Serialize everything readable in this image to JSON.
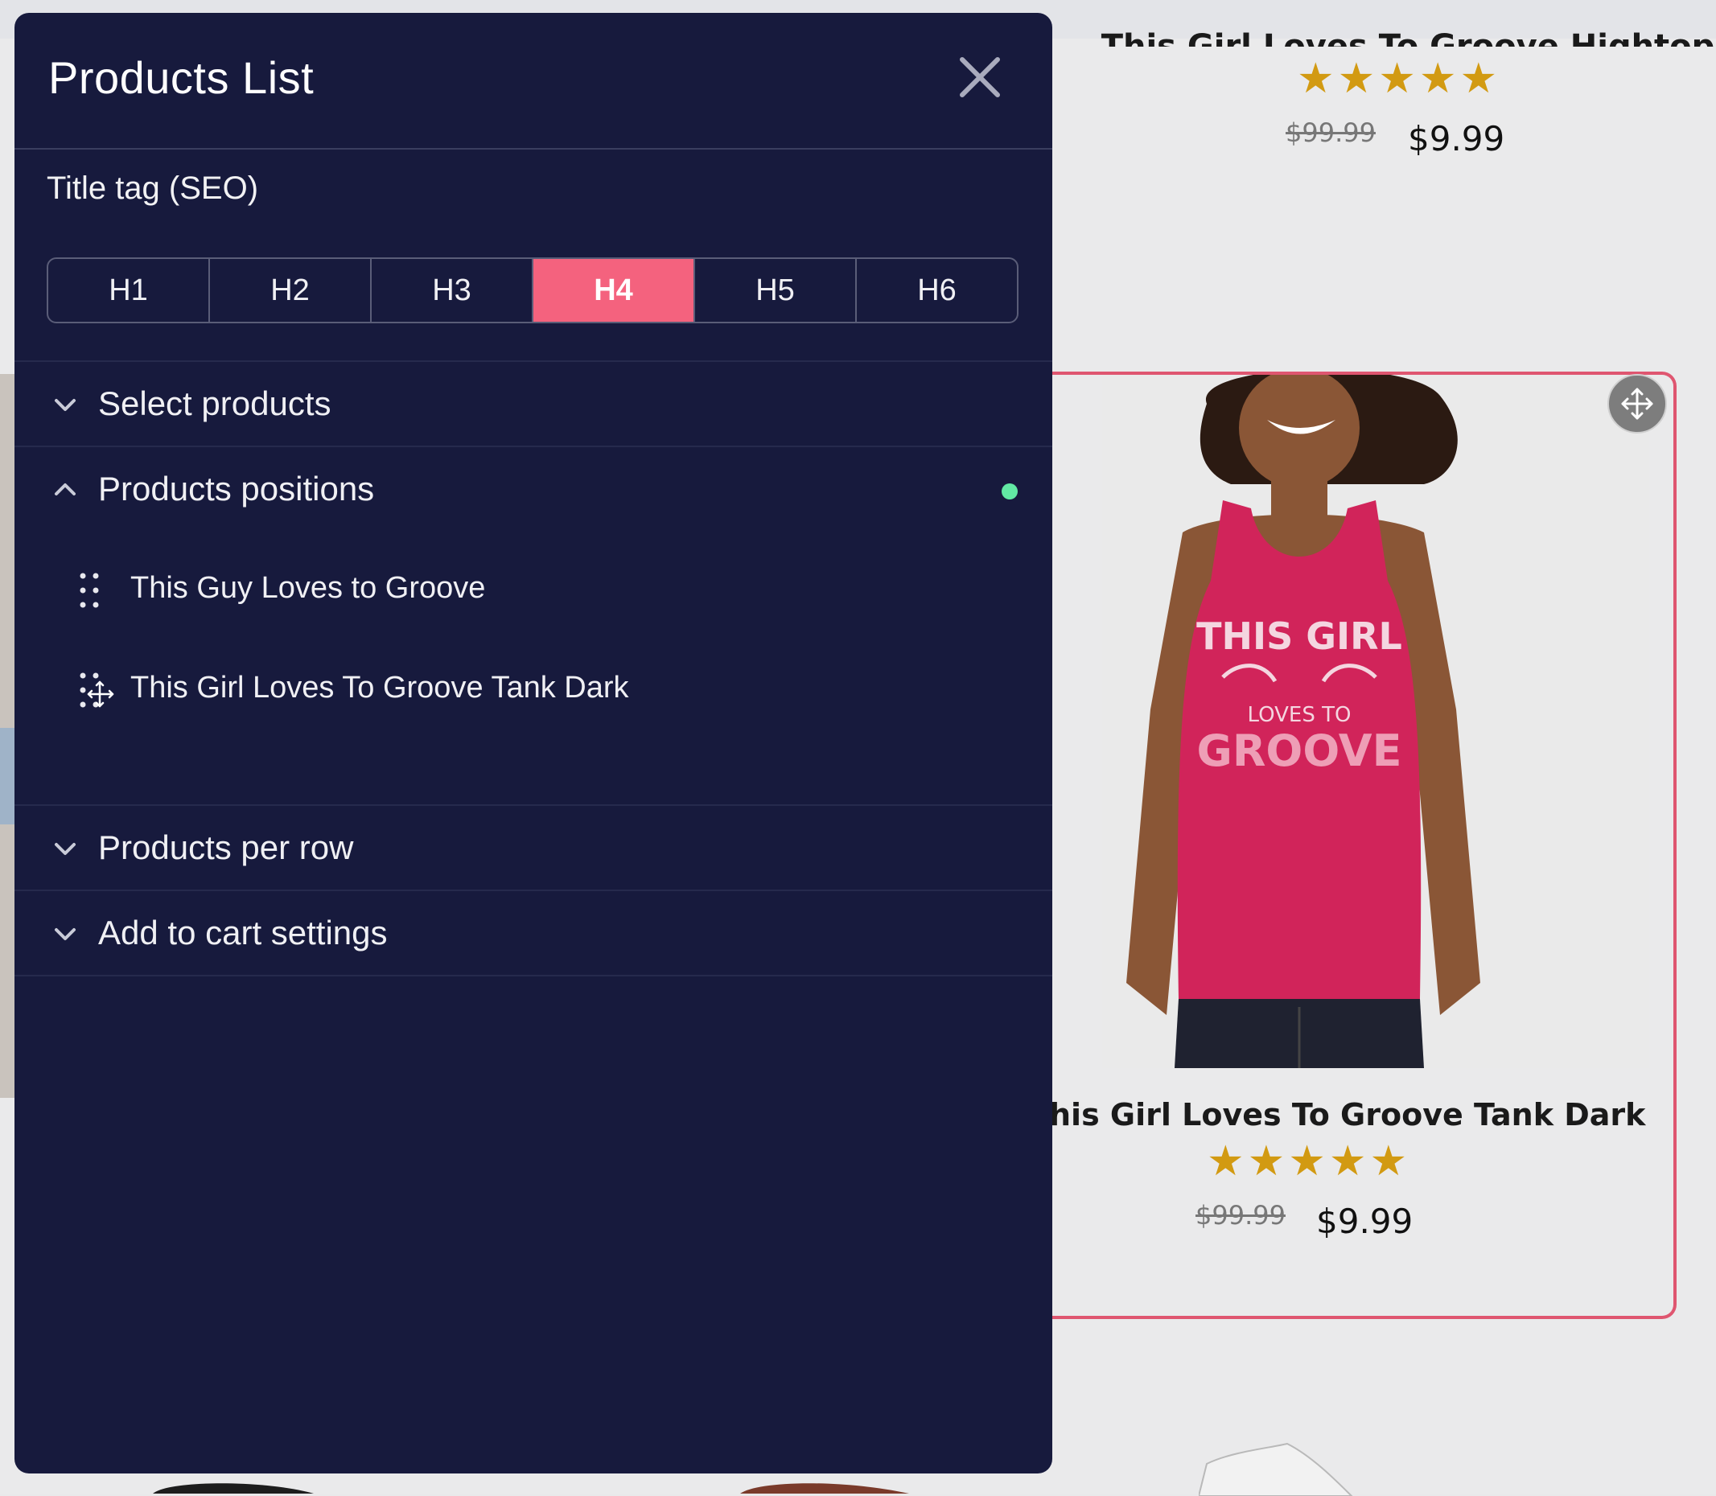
{
  "panel": {
    "title": "Products List",
    "seo_label": "Title tag (SEO)",
    "heading_options": [
      "H1",
      "H2",
      "H3",
      "H4",
      "H5",
      "H6"
    ],
    "selected_heading": "H4",
    "sections": {
      "select_products": "Select products",
      "products_positions": "Products positions",
      "products_per_row": "Products per row",
      "add_to_cart": "Add to cart settings"
    },
    "positions": [
      "This Guy Loves to Groove",
      "This Girl Loves To Groove Tank Dark"
    ]
  },
  "store": {
    "top_card": {
      "title": "This Girl Loves To Groove Hightop",
      "rating": 5,
      "old_price": "$99.99",
      "price": "$9.99"
    },
    "selected_card": {
      "title": "his Girl Loves To Groove Tank Dark",
      "shirt_text_1": "THIS GIRL",
      "shirt_text_2": "LOVES TO",
      "shirt_text_3": "GROOVE",
      "rating": 5,
      "old_price": "$99.99",
      "price": "$9.99"
    }
  },
  "colors": {
    "panel_bg": "#171a3d",
    "accent": "#f4627e",
    "status_green": "#62e8a4",
    "star_gold": "#d29a12",
    "selection_border": "#df5670"
  }
}
